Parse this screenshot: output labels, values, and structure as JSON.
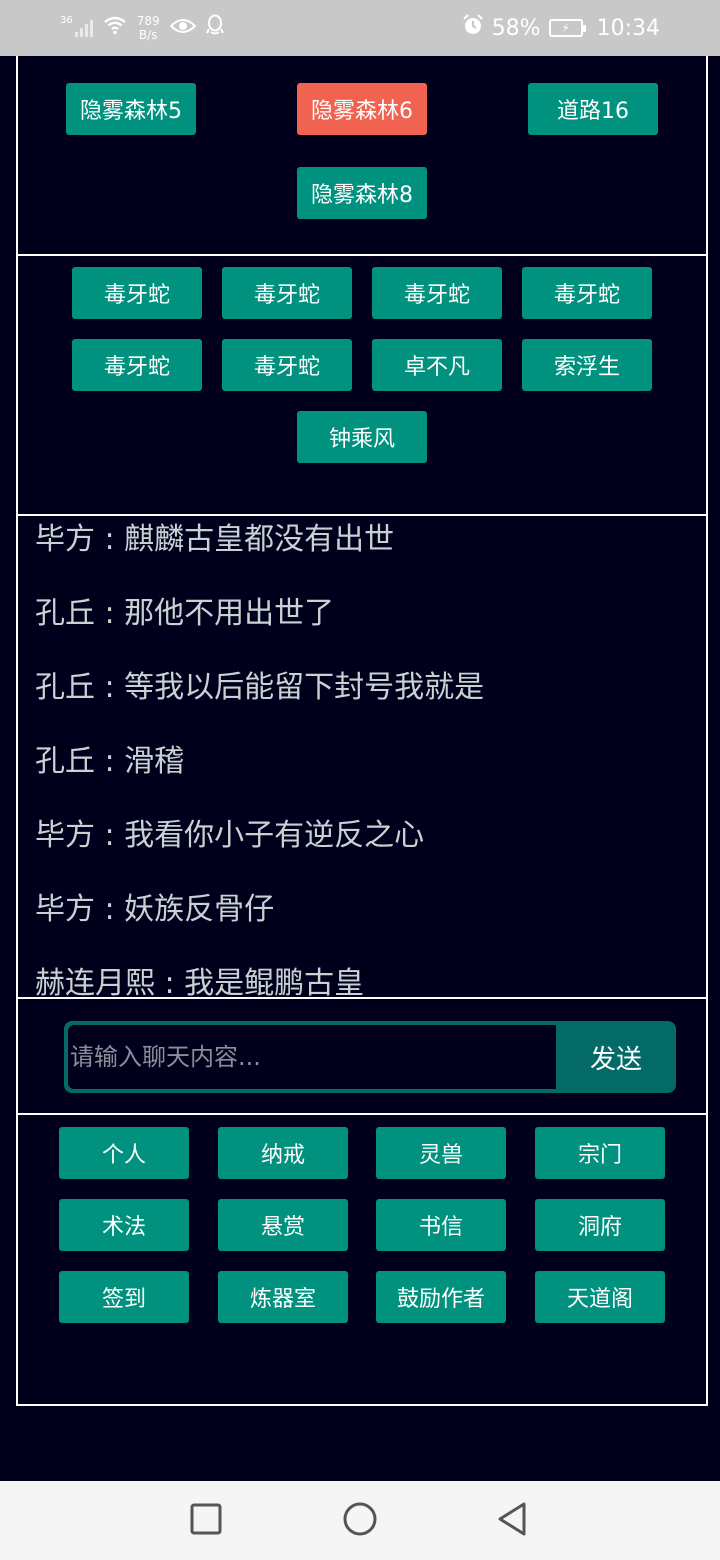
{
  "status_bar": {
    "network_type": "36",
    "net_speed_value": "789",
    "net_speed_unit": "B/s",
    "battery": "58%",
    "time": "10:34",
    "icons": [
      "signal-icon",
      "wifi-icon",
      "eye-icon",
      "qq-icon",
      "alarm-icon",
      "battery-icon"
    ]
  },
  "locations": {
    "items": [
      {
        "label": "隐雾森林5",
        "active": false
      },
      {
        "label": "隐雾森林6",
        "active": true
      },
      {
        "label": "道路16",
        "active": false
      },
      {
        "label": "隐雾森林8",
        "active": false
      }
    ]
  },
  "npcs": {
    "items": [
      "毒牙蛇",
      "毒牙蛇",
      "毒牙蛇",
      "毒牙蛇",
      "毒牙蛇",
      "毒牙蛇",
      "卓不凡",
      "索浮生",
      "钟乘风"
    ]
  },
  "chat": {
    "messages": [
      "毕方 : 麒麟古皇都没有出世",
      "孔丘 : 那他不用出世了",
      "孔丘 : 等我以后能留下封号我就是",
      "孔丘 : 滑稽",
      "毕方 : 我看你小子有逆反之心",
      "毕方 : 妖族反骨仔",
      "赫连月熙 : 我是鲲鹏古皇"
    ],
    "input_placeholder": "请输入聊天内容...",
    "input_value": "",
    "send_label": "发送"
  },
  "menu": {
    "items": [
      "个人",
      "纳戒",
      "灵兽",
      "宗门",
      "术法",
      "悬赏",
      "书信",
      "洞府",
      "签到",
      "炼器室",
      "鼓励作者",
      "天道阁"
    ]
  },
  "colors": {
    "background": "#00001c",
    "button": "#00927e",
    "button_active": "#f06350",
    "frame_border": "#ffffff",
    "chat_text": "#c8d2d2",
    "input_frame": "#046a68"
  }
}
